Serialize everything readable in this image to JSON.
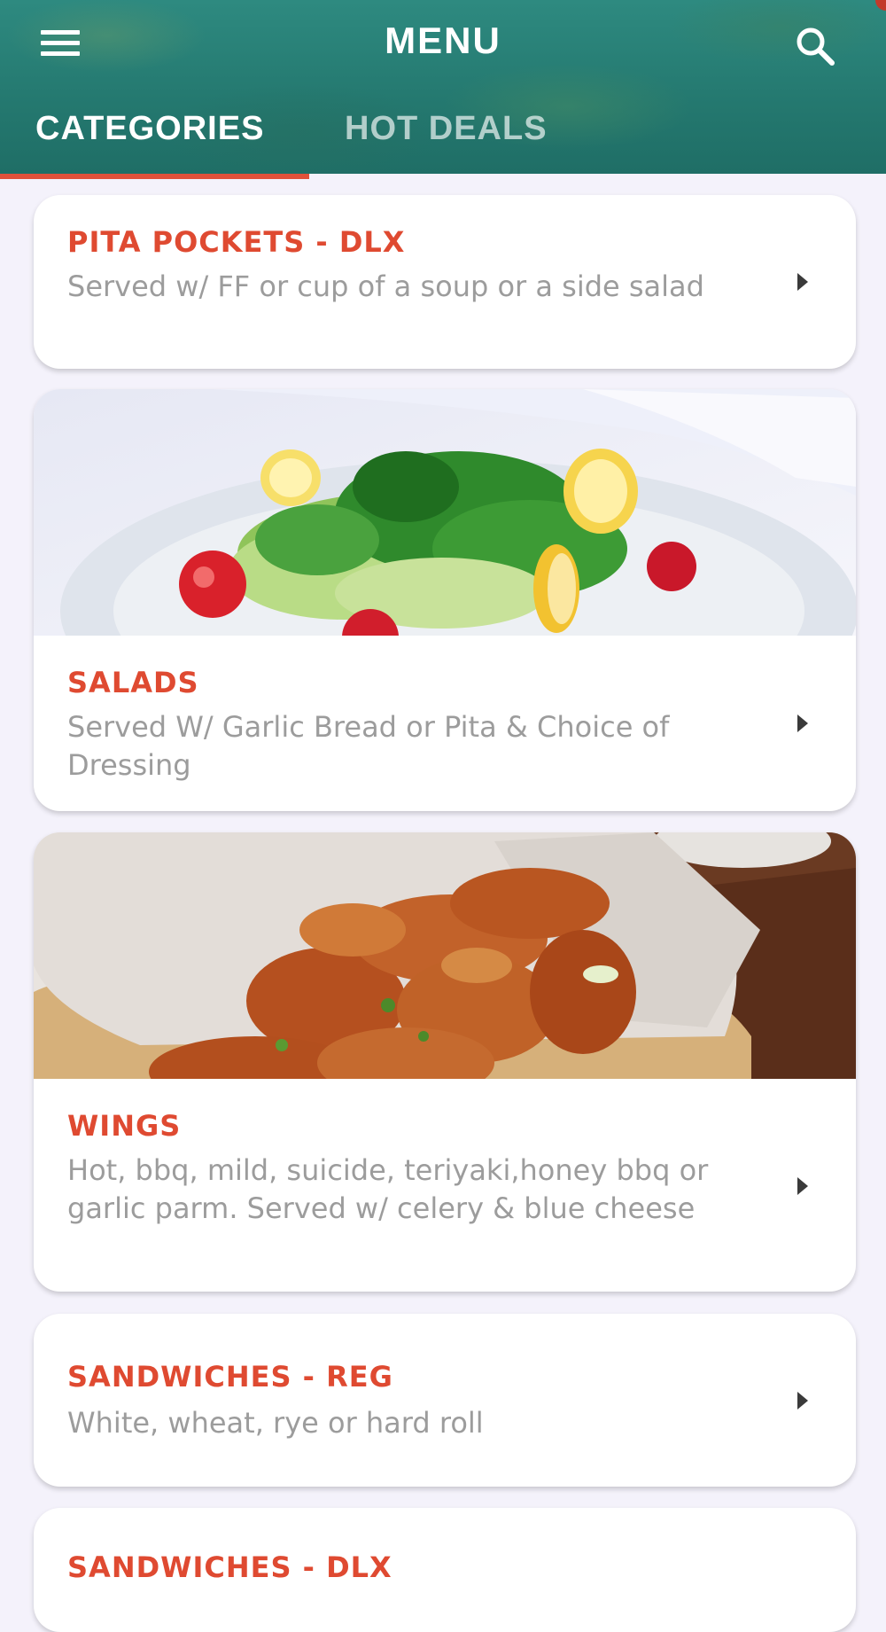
{
  "header": {
    "title": "MENU",
    "tabs": [
      {
        "label": "CATEGORIES",
        "active": true
      },
      {
        "label": "HOT DEALS",
        "active": false
      }
    ],
    "accent_color": "#e0513a",
    "bar_color": "#24786f"
  },
  "categories": [
    {
      "title": "PITA POCKETS - DLX",
      "description": "Served w/ FF or cup of a soup or a side salad"
    },
    {
      "title": "SALADS",
      "description": "Served W/ Garlic Bread or Pita & Choice of Dressing",
      "image": "salad-photo"
    },
    {
      "title": "WINGS",
      "description": "Hot, bbq, mild, suicide, teriyaki,honey bbq or garlic parm. Served w/ celery & blue cheese",
      "image": "wings-photo"
    },
    {
      "title": "SANDWICHES - REG",
      "description": "White, wheat, rye or hard roll"
    },
    {
      "title": "SANDWICHES - DLX",
      "description": ""
    }
  ]
}
